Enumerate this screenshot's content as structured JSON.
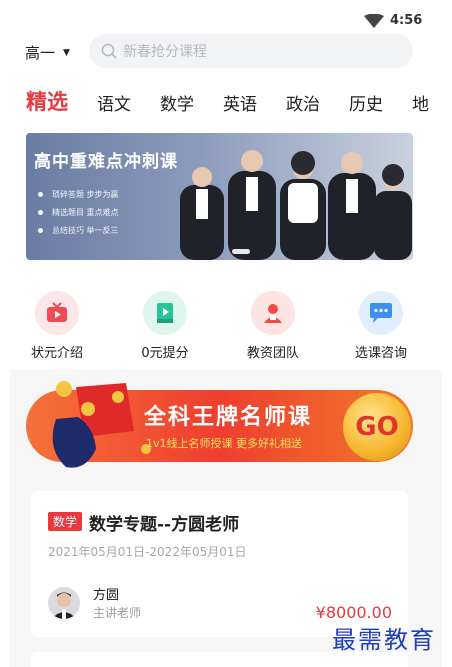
{
  "status_bar": {
    "time": "4:56"
  },
  "header": {
    "grade": "高一",
    "search_placeholder": "新春抢分课程"
  },
  "tabs": [
    "精选",
    "语文",
    "数学",
    "英语",
    "政治",
    "历史",
    "地"
  ],
  "hero_banner": {
    "title": "高中重难点冲刺课",
    "bullets": [
      "琐碎答题 步步为赢",
      "精选题目 重点难点",
      "总结技巧 举一反三"
    ]
  },
  "quick_links": [
    {
      "label": "状元介绍",
      "icon": "tv-icon",
      "color": "#f04a55"
    },
    {
      "label": "0元提分",
      "icon": "book-icon",
      "color": "#27c39a"
    },
    {
      "label": "教资团队",
      "icon": "teacher-icon",
      "color": "#ef4c44"
    },
    {
      "label": "选课咨询",
      "icon": "chat-icon",
      "color": "#3d8ff0"
    }
  ],
  "promo": {
    "title": "全科王牌名师课",
    "subtitle": "1v1线上名师授课 更多好礼相送",
    "button": "GO"
  },
  "course": {
    "tag": "数学",
    "title": "数学专题--方圆老师",
    "dates": "2021年05月01日-2022年05月01日",
    "teacher_name": "方圆",
    "teacher_role": "主讲老师",
    "price": "¥8000.00"
  },
  "watermark": "最需教育"
}
